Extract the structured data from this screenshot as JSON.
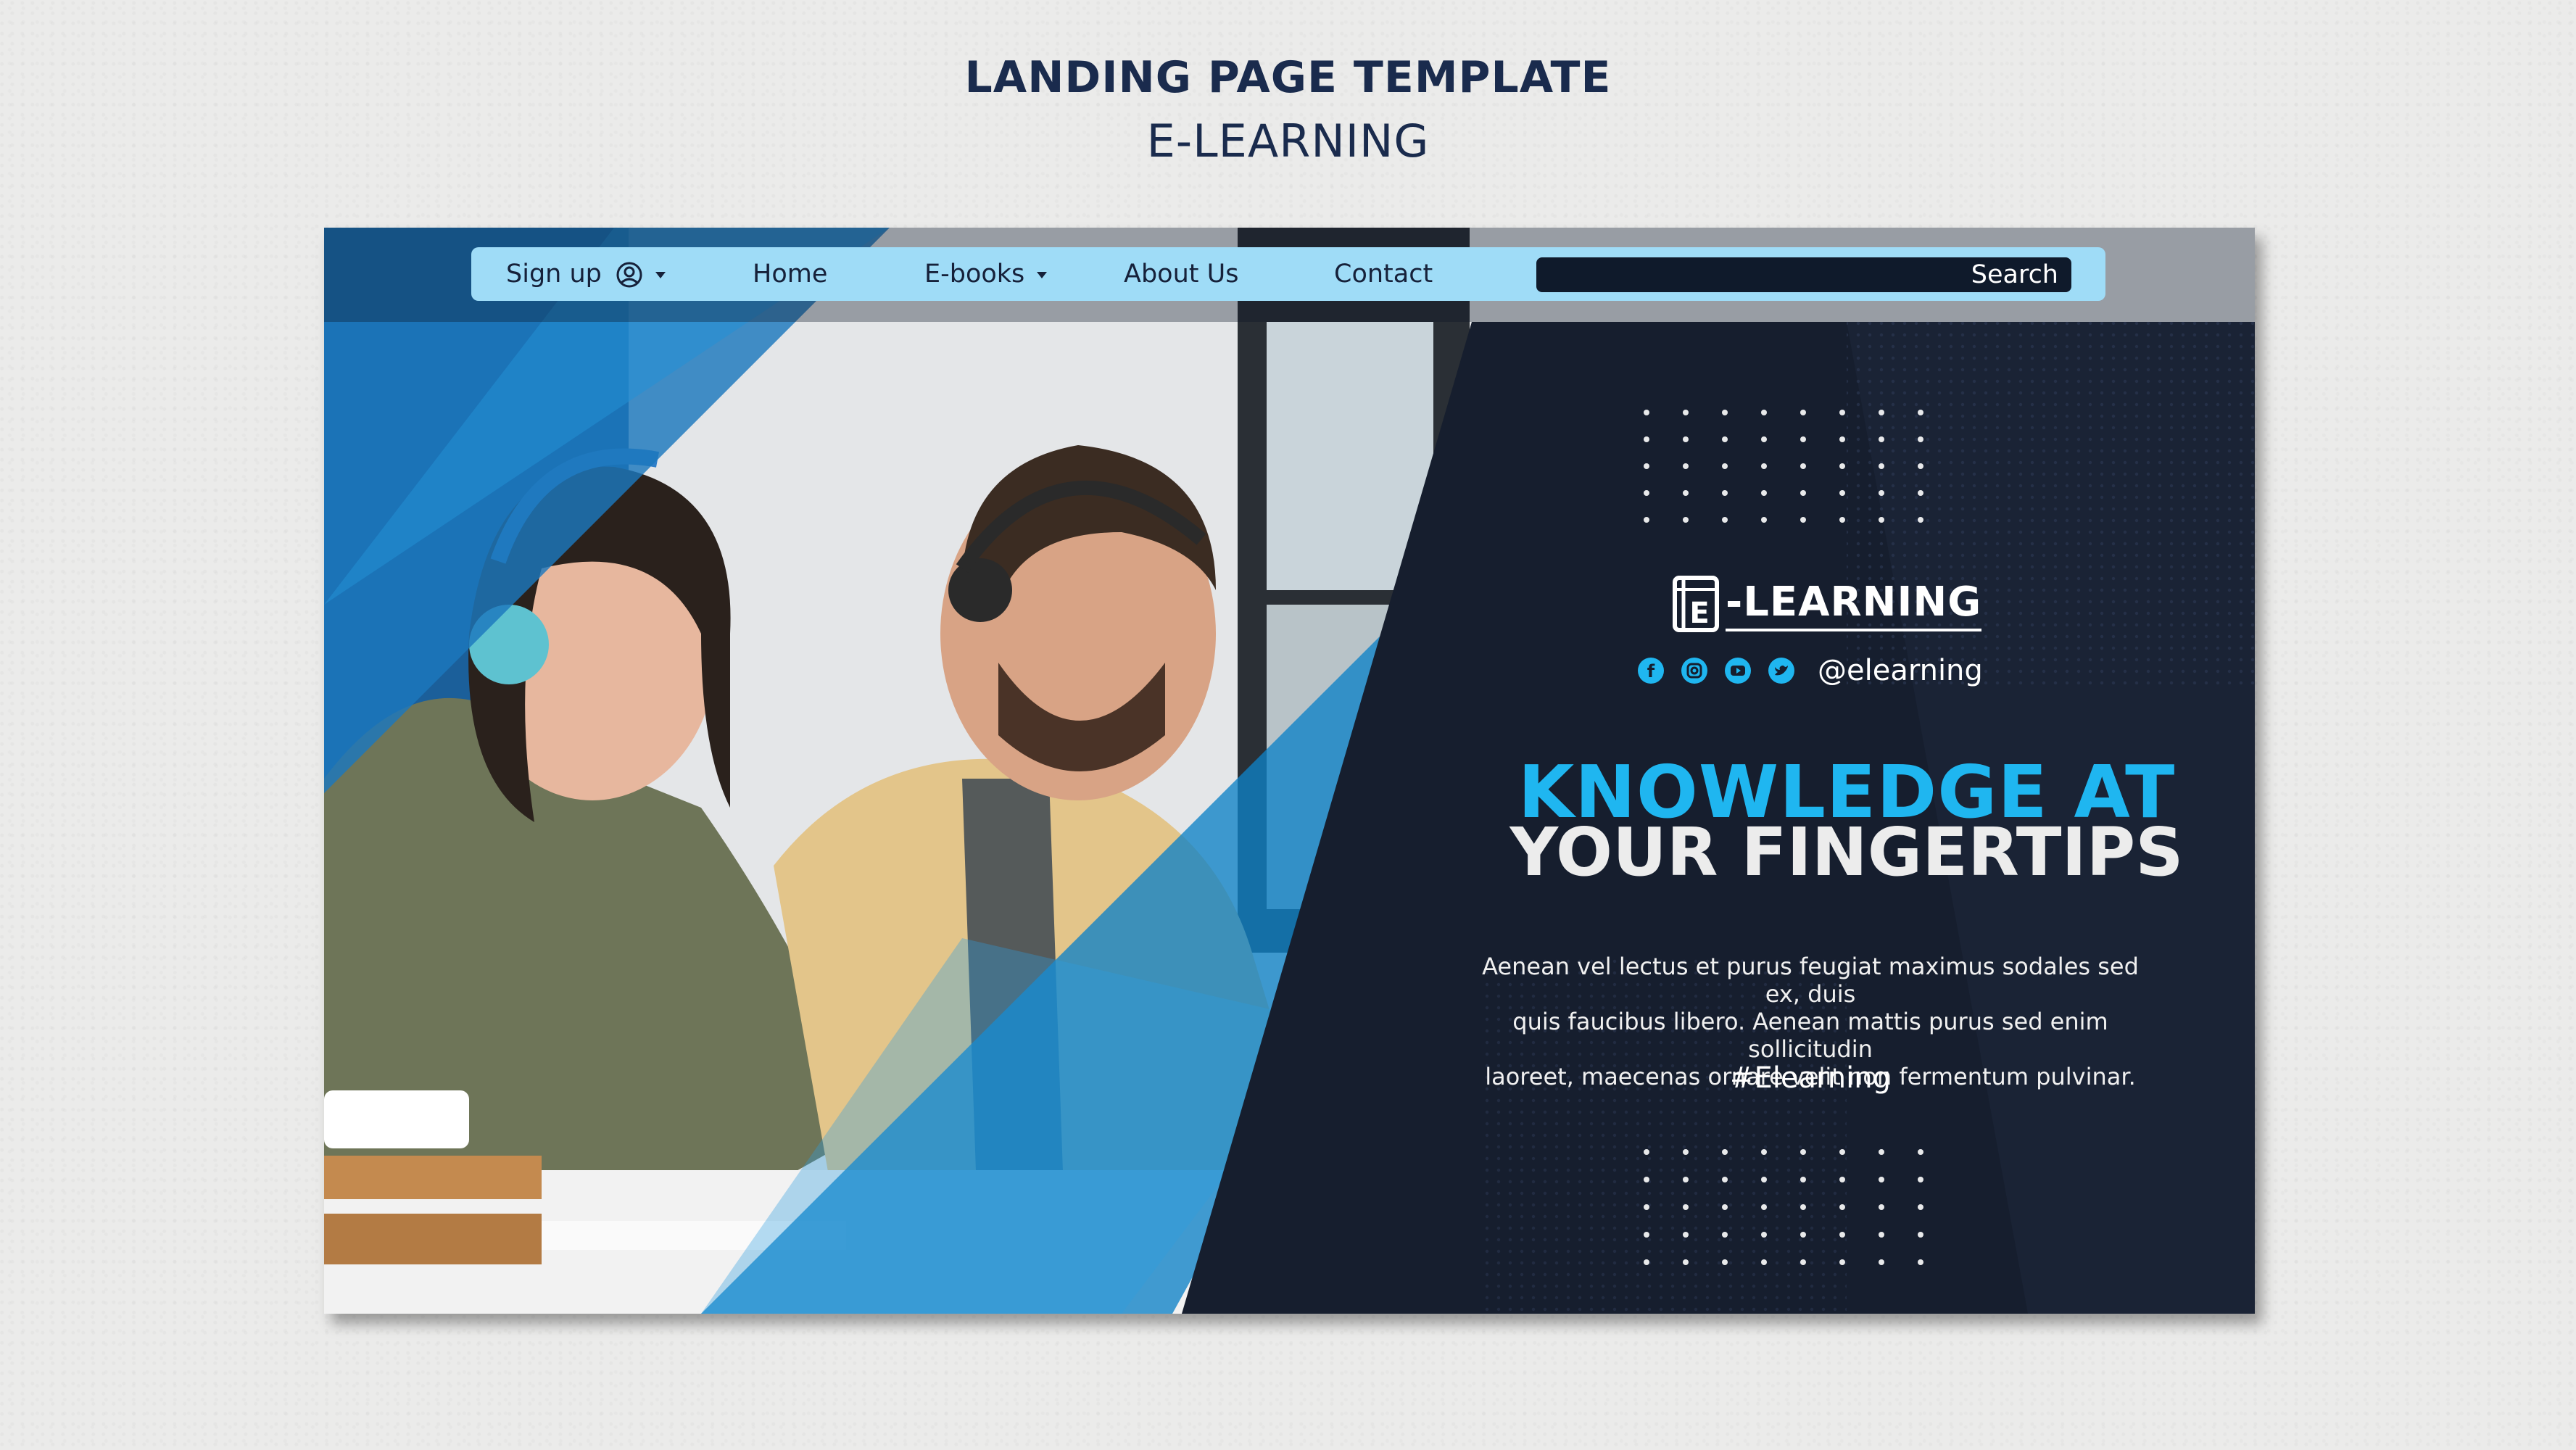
{
  "header": {
    "title": "LANDING PAGE TEMPLATE",
    "subtitle": "E-LEARNING"
  },
  "nav": {
    "signup_label": "Sign up",
    "home_label": "Home",
    "ebooks_label": "E-books",
    "about_label": "About Us",
    "contact_label": "Contact",
    "search_label": "Search",
    "search_value": ""
  },
  "hero": {
    "brand": "-LEARNING",
    "brand_logo_letter": "E",
    "social_handle": "@elearning",
    "social_icons": [
      "facebook-icon",
      "instagram-icon",
      "youtube-icon",
      "twitter-icon"
    ],
    "headline_line1": "KNOWLEDGE AT",
    "headline_line2": "YOUR FINGERTIPS",
    "body_line1": "Aenean vel lectus et purus feugiat maximus sodales sed ex, duis",
    "body_line2": "quis faucibus libero. Aenean mattis purus sed enim sollicitudin",
    "body_line3": "laoreet, maecenas ornare velit non fermentum pulvinar.",
    "hashtag": "#Elearning"
  },
  "colors": {
    "accent": "#1fb6f0",
    "dark_panel": "#161e2e",
    "navbar": "#9fdcf7",
    "heading": "#1a2b4d"
  }
}
